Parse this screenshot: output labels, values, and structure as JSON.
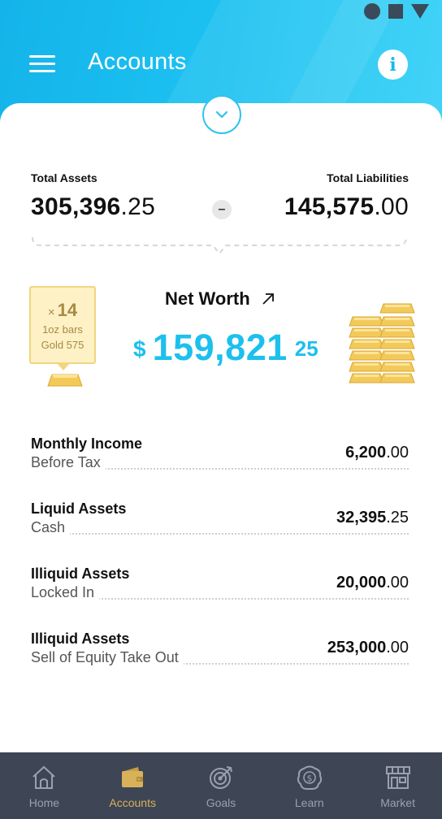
{
  "header": {
    "title": "Accounts",
    "info_icon_text": "i"
  },
  "summary": {
    "total_assets_label": "Total Assets",
    "total_assets_whole": "305,396",
    "total_assets_frac": ".25",
    "total_liabilities_label": "Total Liabilities",
    "total_liabilities_whole": "145,575",
    "total_liabilities_frac": ".00",
    "minus_symbol": "–"
  },
  "gold": {
    "multiplier": "×",
    "count": "14",
    "unit": "1oz bars",
    "price": "Gold 575"
  },
  "net_worth": {
    "label": "Net Worth",
    "currency": "$",
    "whole": "159,821",
    "frac": "25"
  },
  "accounts": [
    {
      "title": "Monthly Income",
      "subtitle": "Before Tax",
      "whole": "6,200",
      "frac": ".00"
    },
    {
      "title": "Liquid Assets",
      "subtitle": "Cash",
      "whole": "32,395",
      "frac": ".25"
    },
    {
      "title": "Illiquid Assets",
      "subtitle": "Locked In",
      "whole": "20,000",
      "frac": ".00"
    },
    {
      "title": "Illiquid Assets",
      "subtitle": "Sell of Equity Take Out",
      "whole": "253,000",
      "frac": ".00"
    }
  ],
  "nav": {
    "items": [
      {
        "label": "Home",
        "icon": "home-icon"
      },
      {
        "label": "Accounts",
        "icon": "wallet-icon",
        "active": true
      },
      {
        "label": "Goals",
        "icon": "target-icon"
      },
      {
        "label": "Learn",
        "icon": "brain-dollar-icon"
      },
      {
        "label": "Market",
        "icon": "store-icon"
      }
    ]
  },
  "colors": {
    "header": "#1cc0f0",
    "accent": "#1cc0ee",
    "gold": "#f2c94c",
    "nav_bg": "#3e4555",
    "nav_active": "#d8b25a"
  }
}
